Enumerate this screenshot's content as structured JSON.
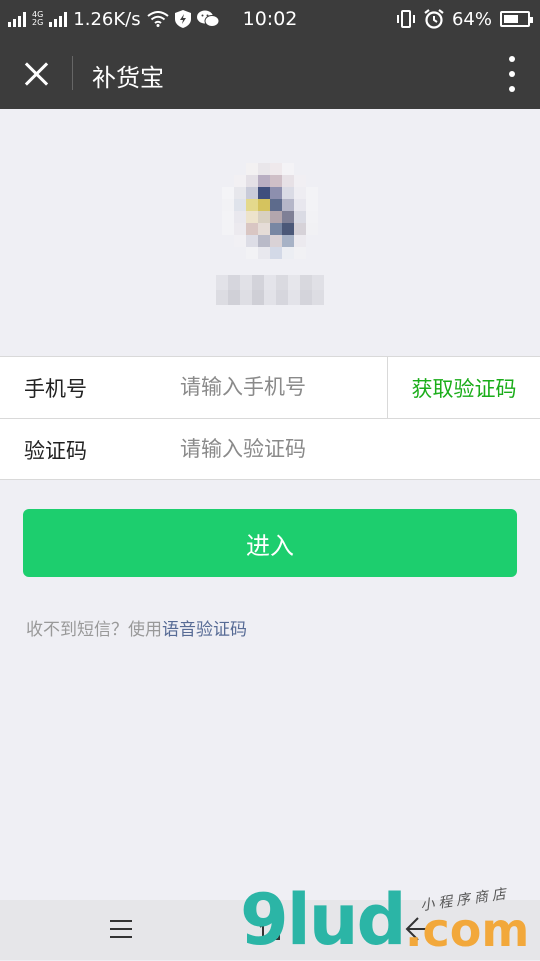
{
  "status_bar": {
    "net_top": "2G",
    "net_mid_top": "4G",
    "net_mid_bottom": "2G",
    "speed": "1.26K/s",
    "time": "10:02",
    "battery_percent": "64%",
    "battery_level": 0.64
  },
  "nav": {
    "title": "补货宝"
  },
  "form": {
    "phone_label": "手机号",
    "phone_placeholder": "请输入手机号",
    "get_code_label": "获取验证码",
    "code_label": "验证码",
    "code_placeholder": "请输入验证码"
  },
  "enter_button_label": "进入",
  "tip": {
    "prefix": "收不到短信？使用",
    "link": "语音验证码"
  },
  "watermark": {
    "main": "9lud",
    "dot_com": ".com",
    "sub": "小程序商店"
  },
  "colors": {
    "header_bg": "#3c3c3c",
    "accent_green": "#1dce6e",
    "link_green": "#1aad19",
    "link_blue": "#576b95",
    "page_bg": "#efeff4"
  }
}
